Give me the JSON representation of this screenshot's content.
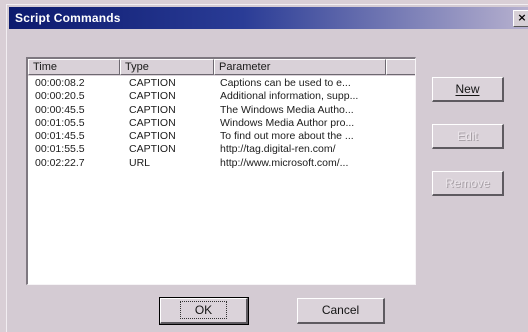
{
  "window": {
    "title": "Script Commands",
    "close_glyph": "×"
  },
  "list": {
    "columns": [
      "Time",
      "Type",
      "Parameter"
    ],
    "rows": [
      {
        "time": "00:00:08.2",
        "type": "CAPTION",
        "parameter": "Captions can be used to e..."
      },
      {
        "time": "00:00:20.5",
        "type": "CAPTION",
        "parameter": "Additional information, supp..."
      },
      {
        "time": "00:00:45.5",
        "type": "CAPTION",
        "parameter": "The Windows Media Autho..."
      },
      {
        "time": "00:01:05.5",
        "type": "CAPTION",
        "parameter": "Windows Media Author pro..."
      },
      {
        "time": "00:01:45.5",
        "type": "CAPTION",
        "parameter": "To find out more about the ..."
      },
      {
        "time": "00:01:55.5",
        "type": "CAPTION",
        "parameter": "http://tag.digital-ren.com/"
      },
      {
        "time": "00:02:22.7",
        "type": "URL",
        "parameter": "http://www.microsoft.com/..."
      }
    ]
  },
  "buttons": {
    "new": "New",
    "edit": "Edit",
    "remove": "Remove",
    "ok": "OK",
    "cancel": "Cancel"
  },
  "state": {
    "edit_enabled": false,
    "remove_enabled": false
  },
  "colors": {
    "title_bar_start": "#0c1a6e",
    "title_bar_end": "#b7b1cf",
    "dialog_face": "#d4cbd3",
    "list_background": "#ffffff"
  }
}
